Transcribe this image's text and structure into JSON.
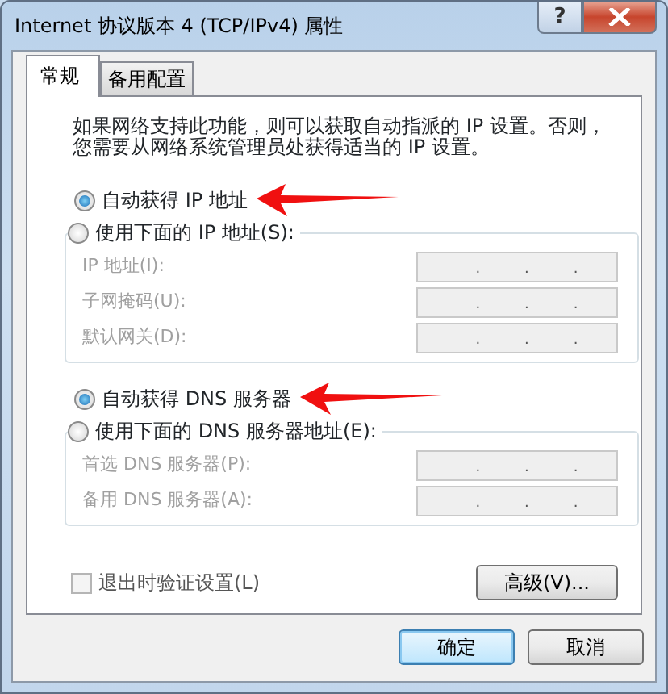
{
  "window": {
    "title": "Internet 协议版本 4 (TCP/IPv4) 属性",
    "help": "?"
  },
  "tabs": [
    {
      "label": "常规",
      "selected": true
    },
    {
      "label": "备用配置",
      "selected": false
    }
  ],
  "description": "如果网络支持此功能，则可以获取自动指派的 IP 设置。否则，您需要从网络系统管理员处获得适当的 IP 设置。",
  "sections": [
    {
      "auto": {
        "label": "自动获得 IP 地址",
        "selected": true,
        "arrow": true
      },
      "manual": {
        "label": "使用下面的 IP 地址(S):",
        "selected": false
      },
      "fields": [
        {
          "label": "IP 地址(I):",
          "disabled": true,
          "separators": [
            ".",
            ".",
            "."
          ]
        },
        {
          "label": "子网掩码(U):",
          "disabled": true,
          "separators": [
            ".",
            ".",
            "."
          ]
        },
        {
          "label": "默认网关(D):",
          "disabled": true,
          "separators": [
            ".",
            ".",
            "."
          ]
        }
      ]
    },
    {
      "auto": {
        "label": "自动获得 DNS 服务器",
        "selected": true,
        "arrow": true
      },
      "manual": {
        "label": "使用下面的 DNS 服务器地址(E):",
        "selected": false
      },
      "fields": [
        {
          "label": "首选 DNS 服务器(P):",
          "disabled": true,
          "separators": [
            ".",
            ".",
            "."
          ]
        },
        {
          "label": "备用 DNS 服务器(A):",
          "disabled": true,
          "separators": [
            ".",
            ".",
            "."
          ]
        }
      ]
    }
  ],
  "validate": {
    "label": "退出时验证设置(L)",
    "checked": false,
    "disabled": true
  },
  "advanced_button": "高级(V)...",
  "buttons": [
    {
      "label": "确定",
      "default": true
    },
    {
      "label": "取消",
      "default": false
    }
  ]
}
